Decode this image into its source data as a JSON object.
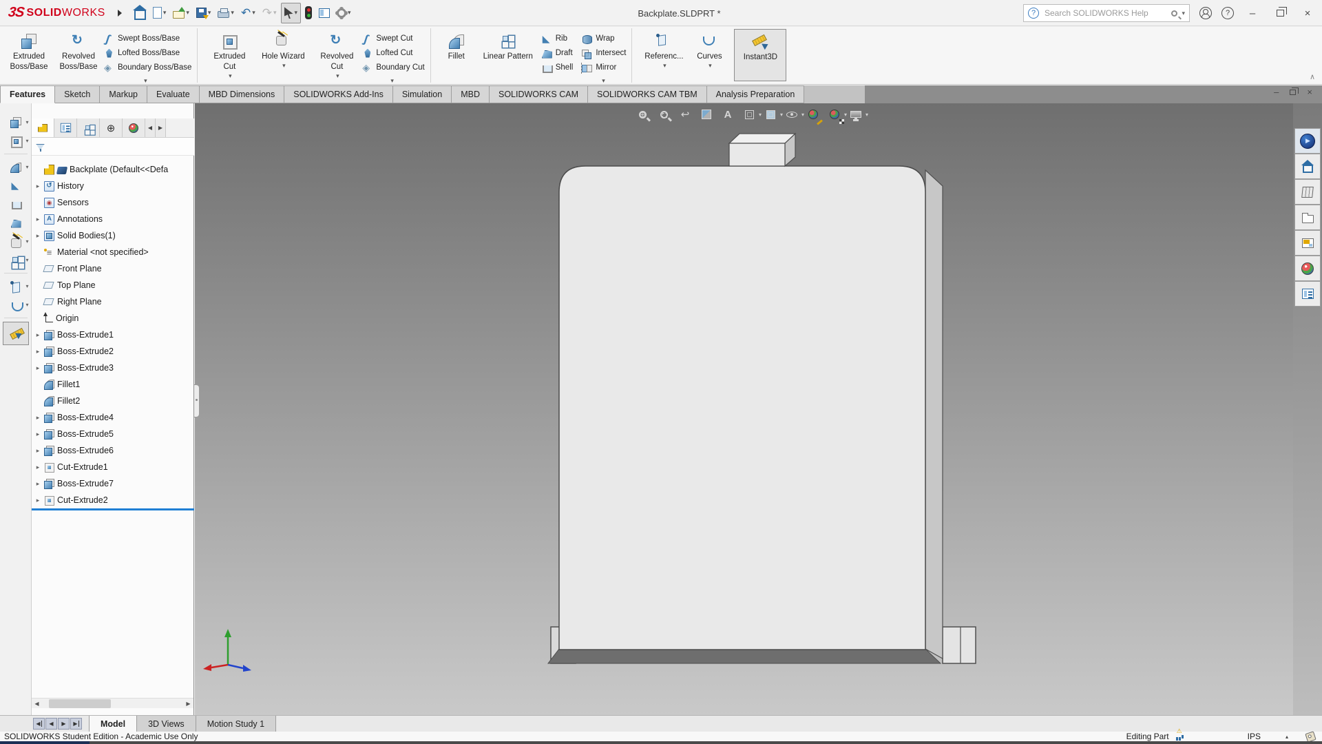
{
  "app": {
    "logo_mark": "3S",
    "logo_solid": "SOLID",
    "logo_works": "WORKS"
  },
  "titlebar": {
    "title": "Backplate.SLDPRT *",
    "search_placeholder": "Search SOLIDWORKS Help",
    "icons": [
      "home-icon",
      "new-document-icon",
      "open-icon",
      "save-icon",
      "print-icon",
      "undo-icon",
      "redo-icon",
      "select-cursor-icon",
      "performance-evaluation-icon",
      "display-pane-icon",
      "options-gear-icon",
      "help-circle-icon",
      "search-magnifier-icon",
      "account-icon",
      "help-icon",
      "minimize-icon",
      "restore-icon",
      "close-icon"
    ]
  },
  "ribbon": {
    "group1": {
      "big": [
        {
          "l1": "Extruded",
          "l2": "Boss/Base"
        },
        {
          "l1": "Revolved",
          "l2": "Boss/Base"
        }
      ],
      "stack": [
        "Swept Boss/Base",
        "Lofted Boss/Base",
        "Boundary Boss/Base"
      ]
    },
    "group2": {
      "big": [
        {
          "l1": "Extruded",
          "l2": "Cut"
        },
        {
          "l1": "Hole Wizard",
          "l2": ""
        },
        {
          "l1": "Revolved",
          "l2": "Cut"
        }
      ],
      "stack": [
        "Swept Cut",
        "Lofted Cut",
        "Boundary Cut"
      ]
    },
    "group3": {
      "big": [
        {
          "l1": "Fillet",
          "l2": ""
        },
        {
          "l1": "Linear Pattern",
          "l2": ""
        }
      ],
      "stack_a": [
        "Rib",
        "Draft",
        "Shell"
      ],
      "stack_b": [
        "Wrap",
        "Intersect",
        "Mirror"
      ]
    },
    "group4": {
      "big": [
        {
          "l1": "Referenc...",
          "l2": ""
        },
        {
          "l1": "Curves",
          "l2": ""
        },
        {
          "l1": "Instant3D",
          "l2": ""
        }
      ]
    }
  },
  "command_tabs": {
    "active": "Features",
    "items": [
      "Features",
      "Sketch",
      "Markup",
      "Evaluate",
      "MBD Dimensions",
      "SOLIDWORKS Add-Ins",
      "Simulation",
      "MBD",
      "SOLIDWORKS CAM",
      "SOLIDWORKS CAM TBM",
      "Analysis Preparation"
    ]
  },
  "tree": {
    "root": "Backplate  (Default<<Defa",
    "items": [
      {
        "label": "History"
      },
      {
        "label": "Sensors"
      },
      {
        "label": "Annotations"
      },
      {
        "label": "Solid Bodies(1)"
      },
      {
        "label": "Material <not specified>"
      },
      {
        "label": "Front Plane"
      },
      {
        "label": "Top Plane"
      },
      {
        "label": "Right Plane"
      },
      {
        "label": "Origin"
      },
      {
        "label": "Boss-Extrude1"
      },
      {
        "label": "Boss-Extrude2"
      },
      {
        "label": "Boss-Extrude3"
      },
      {
        "label": "Fillet1"
      },
      {
        "label": "Fillet2"
      },
      {
        "label": "Boss-Extrude4"
      },
      {
        "label": "Boss-Extrude5"
      },
      {
        "label": "Boss-Extrude6"
      },
      {
        "label": "Cut-Extrude1"
      },
      {
        "label": "Boss-Extrude7"
      },
      {
        "label": "Cut-Extrude2"
      }
    ]
  },
  "viewport": {
    "headsup_icons": [
      "zoom-to-fit-icon",
      "zoom-to-area-icon",
      "previous-view-icon",
      "section-view-icon",
      "dynamic-annotation-views-icon",
      "view-orientation-icon",
      "display-style-icon",
      "hide-show-items-icon",
      "edit-appearance-icon",
      "apply-scene-icon",
      "view-settings-icon"
    ],
    "triad_axes": [
      "x-red",
      "y-green",
      "z-blue"
    ]
  },
  "task_pane": {
    "icons": [
      "3dexperience-icon",
      "home-icon",
      "design-library-icon",
      "file-explorer-icon",
      "view-palette-icon",
      "appearances-scenes-icon",
      "custom-properties-icon"
    ]
  },
  "left_toolbar": {
    "icons": [
      "extruded-boss-base-icon",
      "extruded-cut-icon",
      "fillet-icon",
      "rib-icon",
      "shell-icon",
      "draft-icon",
      "hole-wizard-icon",
      "linear-pattern-icon",
      "reference-geometry-icon",
      "curves-icon",
      "instant3d-icon"
    ]
  },
  "bottom_tabs": {
    "active": "Model",
    "items": [
      "Model",
      "3D Views",
      "Motion Study 1"
    ]
  },
  "statusbar": {
    "left": "SOLIDWORKS Student Edition - Academic Use Only",
    "mode": "Editing Part",
    "units": "IPS"
  },
  "colors": {
    "accent_blue": "#2f80c6",
    "logo_red": "#d0021b",
    "rollback_bar": "#1f7fd4",
    "part_face": "#e9e9e9",
    "viewport_top": "#6f6f6f",
    "viewport_bottom": "#c9c9c9"
  }
}
